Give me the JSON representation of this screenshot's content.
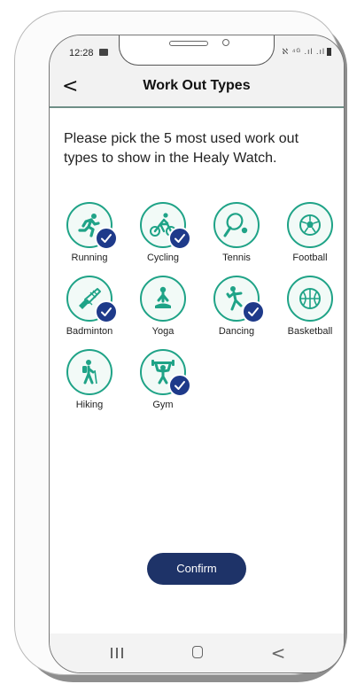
{
  "status_bar": {
    "time": "12:28",
    "right_icons": "ℵ ⁴ᴳ .ıl .ıl"
  },
  "header": {
    "title": "Work Out Types",
    "back_symbol": "<"
  },
  "instruction": "Please pick the 5 most used work out types to show in the Healy Watch.",
  "workouts": [
    {
      "label": "Running",
      "icon": "running-icon",
      "selected": true
    },
    {
      "label": "Cycling",
      "icon": "cycling-icon",
      "selected": true
    },
    {
      "label": "Tennis",
      "icon": "tennis-icon",
      "selected": false
    },
    {
      "label": "Football",
      "icon": "football-icon",
      "selected": false
    },
    {
      "label": "Badminton",
      "icon": "badminton-icon",
      "selected": true
    },
    {
      "label": "Yoga",
      "icon": "yoga-icon",
      "selected": false
    },
    {
      "label": "Dancing",
      "icon": "dancing-icon",
      "selected": true
    },
    {
      "label": "Basketball",
      "icon": "basketball-icon",
      "selected": false
    },
    {
      "label": "Hiking",
      "icon": "hiking-icon",
      "selected": false
    },
    {
      "label": "Gym",
      "icon": "gym-icon",
      "selected": true
    }
  ],
  "confirm_label": "Confirm",
  "colors": {
    "accent": "#1fa387",
    "check_bg": "#1e3a8a",
    "button_bg": "#1e3368"
  }
}
